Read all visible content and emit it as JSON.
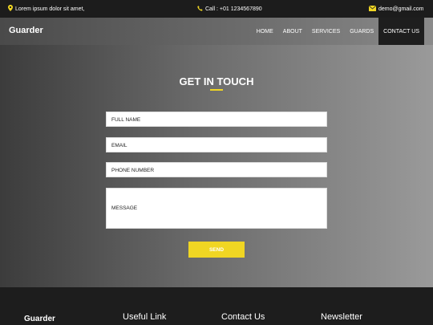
{
  "topbar": {
    "location_text": "Lorem ipsum dolor sit amet,",
    "call_text": "Call : +01 1234567890",
    "email_text": "demo@gmail.com"
  },
  "header": {
    "brand": "Guarder",
    "nav": [
      "HOME",
      "ABOUT",
      "SERVICES",
      "GUARDS",
      "CONTACT US"
    ],
    "active_nav": "CONTACT US"
  },
  "contact": {
    "title": "GET IN TOUCH",
    "full_name_placeholder": "FULL NAME",
    "email_placeholder": "EMAIL",
    "phone_placeholder": "PHONE NUMBER",
    "message_placeholder": "MESSAGE",
    "send_label": "SEND"
  },
  "footer": {
    "brand": "Guarder",
    "useful_link": "Useful Link",
    "contact_us": "Contact Us",
    "newsletter": "Newsletter"
  },
  "colors": {
    "accent": "#f0d623",
    "topbar_bg": "#1c1c1c",
    "active_nav_bg": "#1e1e1e",
    "footer_bg": "#1d1d1d"
  }
}
